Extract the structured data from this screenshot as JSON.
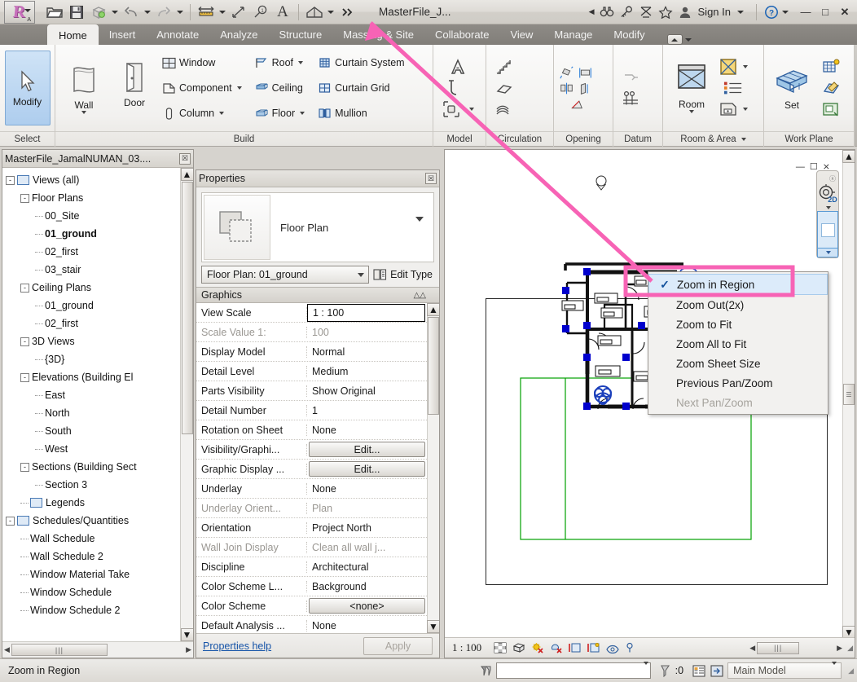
{
  "titlebar": {
    "document_title": "MasterFile_J...",
    "sign_in": "Sign In",
    "quick_access": [
      {
        "name": "open-icon",
        "label": "Open"
      },
      {
        "name": "save-icon",
        "label": "Save"
      },
      {
        "name": "export-icon",
        "label": "Export"
      },
      {
        "name": "undo-icon",
        "label": "Undo"
      },
      {
        "name": "redo-icon",
        "label": "Redo"
      },
      {
        "name": "measure-icon",
        "label": "Measure"
      },
      {
        "name": "aligned-dimension-icon",
        "label": "Aligned Dimension"
      },
      {
        "name": "tag-icon",
        "label": "Tag"
      },
      {
        "name": "text-icon",
        "label": "Text"
      },
      {
        "name": "default-3d-view-icon",
        "label": "Default 3D View"
      },
      {
        "name": "more-icon",
        "label": "More"
      }
    ],
    "info_icons": [
      {
        "name": "search-binoculars-icon"
      },
      {
        "name": "key-icon"
      },
      {
        "name": "communication-center-icon"
      },
      {
        "name": "favorites-star-icon"
      },
      {
        "name": "user-icon"
      }
    ],
    "help_label": "?",
    "window_buttons": [
      "minimize",
      "maximize",
      "close"
    ]
  },
  "tabs": {
    "items": [
      {
        "label": "Home",
        "active": true
      },
      {
        "label": "Insert",
        "active": false
      },
      {
        "label": "Annotate",
        "active": false
      },
      {
        "label": "Analyze",
        "active": false
      },
      {
        "label": "Structure",
        "active": false
      },
      {
        "label": "Massing & Site",
        "active": false
      },
      {
        "label": "Collaborate",
        "active": false
      },
      {
        "label": "View",
        "active": false
      },
      {
        "label": "Manage",
        "active": false
      },
      {
        "label": "Modify",
        "active": false
      }
    ]
  },
  "ribbon": {
    "panels": [
      {
        "title": "Select",
        "big_buttons": [
          {
            "label": "Modify",
            "icon": "arrow-cursor-icon",
            "selected": true
          }
        ],
        "small_items": []
      },
      {
        "title": "Build",
        "big_buttons": [
          {
            "label": "Wall",
            "icon": "wall-icon",
            "dropdown": true
          },
          {
            "label": "Door",
            "icon": "door-icon",
            "dropdown": false
          }
        ],
        "columns": [
          [
            {
              "label": "Window",
              "icon": "window-icon",
              "dropdown": false
            },
            {
              "label": "Component",
              "icon": "component-icon",
              "dropdown": true
            },
            {
              "label": "Column",
              "icon": "column-icon",
              "dropdown": true
            }
          ],
          [
            {
              "label": "Roof",
              "icon": "roof-icon",
              "dropdown": true
            },
            {
              "label": "Ceiling",
              "icon": "ceiling-icon",
              "dropdown": false
            },
            {
              "label": "Floor",
              "icon": "floor-icon",
              "dropdown": true
            }
          ],
          [
            {
              "label": "Curtain System",
              "icon": "curtain-system-icon",
              "dropdown": false
            },
            {
              "label": "Curtain Grid",
              "icon": "curtain-grid-icon",
              "dropdown": false
            },
            {
              "label": "Mullion",
              "icon": "mullion-icon",
              "dropdown": false
            }
          ]
        ]
      },
      {
        "title": "Model",
        "icons": [
          [
            "model-text-icon"
          ],
          [
            "model-line-icon"
          ],
          [
            "model-group-icon"
          ]
        ]
      },
      {
        "title": "Circulation",
        "icons": [
          [
            "stair-icon"
          ],
          [
            "ramp-icon"
          ],
          [
            "railing-icon"
          ]
        ]
      },
      {
        "title": "Opening",
        "icons": [
          [
            "by-face-opening-icon",
            "shaft-opening-icon"
          ],
          [
            "wall-opening-icon",
            "vertical-opening-icon"
          ],
          [
            "dormer-opening-icon"
          ]
        ]
      },
      {
        "title": "Datum",
        "icons": [
          [
            "level-icon"
          ],
          [
            "grid-icon"
          ]
        ]
      },
      {
        "title": "Room & Area",
        "dropdown": true,
        "big_buttons": [
          {
            "label": "Room",
            "icon": "room-icon",
            "dropdown": true
          }
        ],
        "icons": [
          [
            "area-icon"
          ],
          [
            "room-separator-icon"
          ],
          [
            "tag-room-icon"
          ]
        ]
      },
      {
        "title": "Work Plane",
        "big_buttons": [
          {
            "label": "Set",
            "icon": "set-workplane-icon",
            "dropdown": false
          }
        ],
        "icons": [
          [
            "show-workplane-icon"
          ],
          [
            "ref-plane-icon"
          ],
          [
            "viewer-workplane-icon"
          ]
        ]
      }
    ]
  },
  "project_browser": {
    "title": "MasterFile_JamalNUMAN_03....",
    "close_label": "☒",
    "tree": [
      {
        "label": "Views (all)",
        "depth": 0,
        "expander": "-",
        "icon": "views-icon",
        "bold": false
      },
      {
        "label": "Floor Plans",
        "depth": 1,
        "expander": "-",
        "bold": false
      },
      {
        "label": "00_Site",
        "depth": 2,
        "expander": "",
        "bold": false
      },
      {
        "label": "01_ground",
        "depth": 2,
        "expander": "",
        "bold": true
      },
      {
        "label": "02_first",
        "depth": 2,
        "expander": "",
        "bold": false
      },
      {
        "label": "03_stair",
        "depth": 2,
        "expander": "",
        "bold": false
      },
      {
        "label": "Ceiling Plans",
        "depth": 1,
        "expander": "-",
        "bold": false
      },
      {
        "label": "01_ground",
        "depth": 2,
        "expander": "",
        "bold": false
      },
      {
        "label": "02_first",
        "depth": 2,
        "expander": "",
        "bold": false
      },
      {
        "label": "3D Views",
        "depth": 1,
        "expander": "-",
        "bold": false
      },
      {
        "label": "{3D}",
        "depth": 2,
        "expander": "",
        "bold": false
      },
      {
        "label": "Elevations (Building El",
        "depth": 1,
        "expander": "-",
        "bold": false
      },
      {
        "label": "East",
        "depth": 2,
        "expander": "",
        "bold": false
      },
      {
        "label": "North",
        "depth": 2,
        "expander": "",
        "bold": false
      },
      {
        "label": "South",
        "depth": 2,
        "expander": "",
        "bold": false
      },
      {
        "label": "West",
        "depth": 2,
        "expander": "",
        "bold": false
      },
      {
        "label": "Sections (Building Sect",
        "depth": 1,
        "expander": "-",
        "bold": false
      },
      {
        "label": "Section 3",
        "depth": 2,
        "expander": "",
        "bold": false
      },
      {
        "label": "Legends",
        "depth": 1,
        "expander": "",
        "icon": "legend-icon",
        "bold": false
      },
      {
        "label": "Schedules/Quantities",
        "depth": 0,
        "expander": "-",
        "icon": "schedule-icon",
        "bold": false
      },
      {
        "label": "Wall Schedule",
        "depth": 1,
        "expander": "",
        "bold": false
      },
      {
        "label": "Wall Schedule 2",
        "depth": 1,
        "expander": "",
        "bold": false
      },
      {
        "label": "Window Material Take",
        "depth": 1,
        "expander": "",
        "bold": false
      },
      {
        "label": "Window Schedule",
        "depth": 1,
        "expander": "",
        "bold": false
      },
      {
        "label": "Window Schedule 2",
        "depth": 1,
        "expander": "",
        "bold": false
      }
    ]
  },
  "properties": {
    "title": "Properties",
    "close_label": "☒",
    "type_family": "Floor Plan",
    "type_selector": "Floor Plan: 01_ground",
    "edit_type_label": "Edit Type",
    "group_header": "Graphics",
    "help_link": "Properties help",
    "apply_label": "Apply",
    "rows": [
      {
        "key": "View Scale",
        "value": "1 : 100",
        "kind": "selected",
        "dim": false
      },
      {
        "key": "Scale Value     1:",
        "value": "100",
        "kind": "text",
        "dim": true
      },
      {
        "key": "Display Model",
        "value": "Normal",
        "kind": "text",
        "dim": false
      },
      {
        "key": "Detail Level",
        "value": "Medium",
        "kind": "text",
        "dim": false
      },
      {
        "key": "Parts Visibility",
        "value": "Show Original",
        "kind": "text",
        "dim": false
      },
      {
        "key": "Detail Number",
        "value": "1",
        "kind": "text",
        "dim": false
      },
      {
        "key": "Rotation on Sheet",
        "value": "None",
        "kind": "text",
        "dim": false
      },
      {
        "key": "Visibility/Graphi...",
        "value": "Edit...",
        "kind": "button",
        "dim": false
      },
      {
        "key": "Graphic Display ...",
        "value": "Edit...",
        "kind": "button",
        "dim": false
      },
      {
        "key": "Underlay",
        "value": "None",
        "kind": "text",
        "dim": false
      },
      {
        "key": "Underlay Orient...",
        "value": "Plan",
        "kind": "text",
        "dim": true
      },
      {
        "key": "Orientation",
        "value": "Project North",
        "kind": "text",
        "dim": false
      },
      {
        "key": "Wall Join Display",
        "value": "Clean all wall j...",
        "kind": "text",
        "dim": true
      },
      {
        "key": "Discipline",
        "value": "Architectural",
        "kind": "text",
        "dim": false
      },
      {
        "key": "Color Scheme L...",
        "value": "Background",
        "kind": "text",
        "dim": false
      },
      {
        "key": "Color Scheme",
        "value": "<none>",
        "kind": "button",
        "dim": false
      },
      {
        "key": "Default Analysis ...",
        "value": "None",
        "kind": "text",
        "dim": false
      }
    ]
  },
  "context_menu": {
    "items": [
      {
        "label": "Zoom in Region",
        "checked": true,
        "highlighted": true,
        "disabled": false
      },
      {
        "label": "Zoom Out(2x)",
        "checked": false,
        "highlighted": false,
        "disabled": false
      },
      {
        "label": "Zoom to Fit",
        "checked": false,
        "highlighted": false,
        "disabled": false
      },
      {
        "label": "Zoom All to Fit",
        "checked": false,
        "highlighted": false,
        "disabled": false
      },
      {
        "label": "Zoom Sheet Size",
        "checked": false,
        "highlighted": false,
        "disabled": false
      },
      {
        "label": "Previous Pan/Zoom",
        "checked": false,
        "highlighted": false,
        "disabled": false
      },
      {
        "label": "Next Pan/Zoom",
        "checked": false,
        "highlighted": false,
        "disabled": true
      }
    ]
  },
  "canvas": {
    "view_scale": "1 : 100",
    "nav_wheel_label": "2D",
    "view_control_icons": [
      {
        "name": "detail-level-icon"
      },
      {
        "name": "visual-style-icon"
      },
      {
        "name": "sun-path-off-icon"
      },
      {
        "name": "shadows-off-icon"
      },
      {
        "name": "render-display-icon"
      },
      {
        "name": "crop-view-icon"
      },
      {
        "name": "hide-crop-region-icon"
      },
      {
        "name": "temporary-hide-isolate-icon"
      },
      {
        "name": "reveal-hidden-elements-icon"
      }
    ]
  },
  "statusbar": {
    "message": "Zoom in Region",
    "filter_icon": "filter-icon",
    "selection_value": "",
    "warning_count": ":0",
    "design_options_icon": "design-options-icon",
    "exclude_options_icon": "exclude-options-icon",
    "main_model": "Main Model"
  },
  "colors": {
    "accent_pink": "#f763b5",
    "selection_blue": "#0000cd",
    "crop_green": "#00a000",
    "link_blue": "#1654a8"
  }
}
